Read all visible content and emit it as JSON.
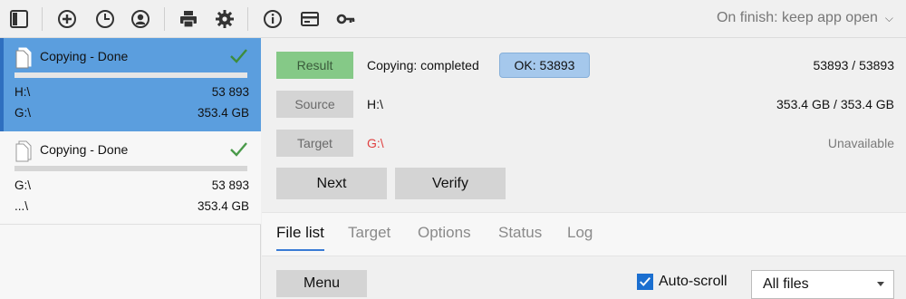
{
  "toolbar": {
    "icons": [
      "sidebar-toggle-icon",
      "add-circle-icon",
      "clock-icon",
      "user-circle-icon",
      "printer-icon",
      "gear-icon",
      "info-icon",
      "card-icon",
      "key-icon"
    ],
    "on_finish": "On finish: keep app open"
  },
  "jobs": [
    {
      "title": "Copying - Done",
      "source": "H:\\",
      "source_value": "53 893",
      "target": "G:\\",
      "target_value": "353.4 GB",
      "progress": 1.0
    },
    {
      "title": "Copying - Done",
      "source": "G:\\",
      "source_value": "53 893",
      "target": "...\\",
      "target_value": "353.4 GB",
      "progress": 1.0
    }
  ],
  "details": {
    "result_label": "Result",
    "result_text": "Copying: completed",
    "ok_badge": "OK: 53893",
    "result_count": "53893 / 53893",
    "source_label": "Source",
    "source_path": "H:\\",
    "source_size": "353.4 GB / 353.4 GB",
    "target_label": "Target",
    "target_path": "G:\\",
    "target_status": "Unavailable"
  },
  "actions": {
    "next": "Next",
    "verify": "Verify"
  },
  "tabs": [
    "File list",
    "Target",
    "Options",
    "Status",
    "Log"
  ],
  "bottom": {
    "menu": "Menu",
    "autoscroll": "Auto-scroll",
    "filter": "All files"
  },
  "colors": {
    "accent": "#5b9ede",
    "success": "#4a9a4a",
    "error": "#e04040",
    "result_green": "#85c987"
  }
}
